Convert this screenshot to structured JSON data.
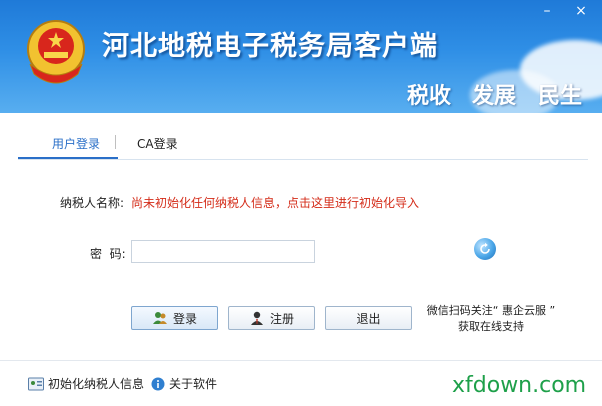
{
  "app": {
    "title": "河北地税电子税务局客户端",
    "slogans": [
      "税收",
      "发展",
      "民生"
    ]
  },
  "window_controls": {
    "minimize": "–",
    "close": "×"
  },
  "tabs": [
    {
      "label": "用户登录",
      "active": true
    },
    {
      "label": "CA登录",
      "active": false
    }
  ],
  "form": {
    "taxpayer_label": "纳税人名称:",
    "taxpayer_notice": "尚未初始化任何纳税人信息，点击这里进行初始化导入",
    "password_label": "密  码:",
    "password_value": "",
    "password_placeholder": ""
  },
  "buttons": {
    "login": "登录",
    "register": "注册",
    "exit": "退出"
  },
  "wechat": {
    "line1": "微信扫码关注“ 惠企云服 ”",
    "line2": "获取在线支持"
  },
  "footer": {
    "init_link": "初始化纳税人信息",
    "about_link": "关于软件",
    "watermark": "xfdown.com"
  },
  "colors": {
    "header_blue": "#2f8fe6",
    "notice_red": "#d42c19",
    "tab_active": "#2a6fc8",
    "watermark_green": "#1ea04a"
  }
}
